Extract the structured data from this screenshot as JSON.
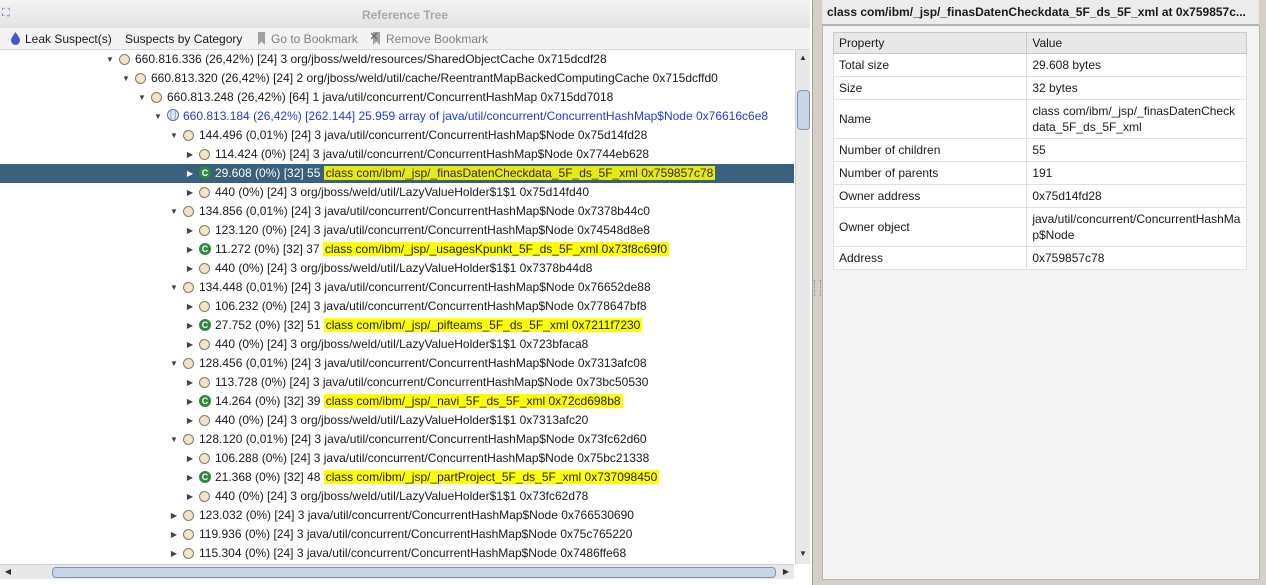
{
  "left_panel": {
    "title": "Reference Tree",
    "toolbar": {
      "leak_suspects": "Leak Suspect(s)",
      "suspects_by_category": "Suspects by Category",
      "go_to_bookmark": "Go to Bookmark",
      "remove_bookmark": "Remove Bookmark"
    },
    "rows": [
      {
        "level": 0,
        "kind": "node",
        "twist": "open",
        "text": "660.816.336 (26,42%) [24] 3 org/jboss/weld/resources/SharedObjectCache 0x715dcdf28"
      },
      {
        "level": 1,
        "kind": "node",
        "twist": "open",
        "text": "660.813.320 (26,42%) [24] 2 org/jboss/weld/util/cache/ReentrantMapBackedComputingCache 0x715dcffd0"
      },
      {
        "level": 2,
        "kind": "node",
        "twist": "open",
        "text": "660.813.248 (26,42%) [64] 1 java/util/concurrent/ConcurrentHashMap 0x715dd7018"
      },
      {
        "level": 3,
        "kind": "array",
        "twist": "open",
        "blue": true,
        "text": "660.813.184 (26,42%) [262.144] 25.959 array of java/util/concurrent/ConcurrentHashMap$Node 0x76616c6e8"
      },
      {
        "level": 4,
        "kind": "node",
        "twist": "open",
        "text": "144.496 (0,01%) [24] 3 java/util/concurrent/ConcurrentHashMap$Node 0x75d14fd28"
      },
      {
        "level": 5,
        "kind": "node",
        "twist": "closed",
        "text": "114.424 (0%) [24] 3 java/util/concurrent/ConcurrentHashMap$Node 0x7744eb628"
      },
      {
        "level": 5,
        "kind": "class",
        "twist": "closed",
        "selected": true,
        "text": "29.608 (0%) [32] 55 ",
        "hl": "class com/ibm/_jsp/_finasDatenCheckdata_5F_ds_5F_xml 0x759857c78"
      },
      {
        "level": 5,
        "kind": "node",
        "twist": "closed",
        "text": "440 (0%) [24] 3 org/jboss/weld/util/LazyValueHolder$1$1 0x75d14fd40"
      },
      {
        "level": 4,
        "kind": "node",
        "twist": "open",
        "text": "134.856 (0,01%) [24] 3 java/util/concurrent/ConcurrentHashMap$Node 0x7378b44c0"
      },
      {
        "level": 5,
        "kind": "node",
        "twist": "closed",
        "text": "123.120 (0%) [24] 3 java/util/concurrent/ConcurrentHashMap$Node 0x74548d8e8"
      },
      {
        "level": 5,
        "kind": "class",
        "twist": "closed",
        "text": "11.272 (0%) [32] 37 ",
        "hl": "class com/ibm/_jsp/_usagesKpunkt_5F_ds_5F_xml 0x73f8c69f0"
      },
      {
        "level": 5,
        "kind": "node",
        "twist": "closed",
        "text": "440 (0%) [24] 3 org/jboss/weld/util/LazyValueHolder$1$1 0x7378b44d8"
      },
      {
        "level": 4,
        "kind": "node",
        "twist": "open",
        "text": "134.448 (0,01%) [24] 3 java/util/concurrent/ConcurrentHashMap$Node 0x76652de88"
      },
      {
        "level": 5,
        "kind": "node",
        "twist": "closed",
        "text": "106.232 (0%) [24] 3 java/util/concurrent/ConcurrentHashMap$Node 0x778647bf8"
      },
      {
        "level": 5,
        "kind": "class",
        "twist": "closed",
        "text": "27.752 (0%) [32] 51 ",
        "hl": "class com/ibm/_jsp/_pifteams_5F_ds_5F_xml 0x7211f7230"
      },
      {
        "level": 5,
        "kind": "node",
        "twist": "closed",
        "text": "440 (0%) [24] 3 org/jboss/weld/util/LazyValueHolder$1$1 0x723bfaca8"
      },
      {
        "level": 4,
        "kind": "node",
        "twist": "open",
        "text": "128.456 (0,01%) [24] 3 java/util/concurrent/ConcurrentHashMap$Node 0x7313afc08"
      },
      {
        "level": 5,
        "kind": "node",
        "twist": "closed",
        "text": "113.728 (0%) [24] 3 java/util/concurrent/ConcurrentHashMap$Node 0x73bc50530"
      },
      {
        "level": 5,
        "kind": "class",
        "twist": "closed",
        "text": "14.264 (0%) [32] 39 ",
        "hl": "class com/ibm/_jsp/_navi_5F_ds_5F_xml 0x72cd698b8"
      },
      {
        "level": 5,
        "kind": "node",
        "twist": "closed",
        "text": "440 (0%) [24] 3 org/jboss/weld/util/LazyValueHolder$1$1 0x7313afc20"
      },
      {
        "level": 4,
        "kind": "node",
        "twist": "open",
        "text": "128.120 (0,01%) [24] 3 java/util/concurrent/ConcurrentHashMap$Node 0x73fc62d60"
      },
      {
        "level": 5,
        "kind": "node",
        "twist": "closed",
        "text": "106.288 (0%) [24] 3 java/util/concurrent/ConcurrentHashMap$Node 0x75bc21338"
      },
      {
        "level": 5,
        "kind": "class",
        "twist": "closed",
        "text": "21.368 (0%) [32] 48 ",
        "hl": "class com/ibm/_jsp/_partProject_5F_ds_5F_xml 0x737098450"
      },
      {
        "level": 5,
        "kind": "node",
        "twist": "closed",
        "text": "440 (0%) [24] 3 org/jboss/weld/util/LazyValueHolder$1$1 0x73fc62d78"
      },
      {
        "level": 4,
        "kind": "node",
        "twist": "closed",
        "text": "123.032 (0%) [24] 3 java/util/concurrent/ConcurrentHashMap$Node 0x766530690"
      },
      {
        "level": 4,
        "kind": "node",
        "twist": "closed",
        "text": "119.936 (0%) [24] 3 java/util/concurrent/ConcurrentHashMap$Node 0x75c765220"
      },
      {
        "level": 4,
        "kind": "node",
        "twist": "closed",
        "text": "115.304 (0%) [24] 3 java/util/concurrent/ConcurrentHashMap$Node 0x7486ffe68"
      }
    ]
  },
  "right_panel": {
    "title": "class com/ibm/_jsp/_finasDatenCheckdata_5F_ds_5F_xml at 0x759857c...",
    "headers": {
      "property": "Property",
      "value": "Value"
    },
    "properties": [
      {
        "name": "Total size",
        "value": "29.608 bytes"
      },
      {
        "name": "Size",
        "value": "32 bytes"
      },
      {
        "name": "Name",
        "value": "class com/ibm/_jsp/_finasDatenCheckdata_5F_ds_5F_xml"
      },
      {
        "name": "Number of children",
        "value": "55"
      },
      {
        "name": "Number of parents",
        "value": "191"
      },
      {
        "name": "Owner address",
        "value": "0x75d14fd28"
      },
      {
        "name": "Owner object",
        "value": "java/util/concurrent/ConcurrentHashMap$Node"
      },
      {
        "name": "Address",
        "value": "0x759857c78"
      }
    ]
  },
  "icons": {
    "tree": "tree-icon",
    "leak": "leak-suspect-icon",
    "bookmark": "bookmark-icon",
    "remove_bookmark": "remove-bookmark-icon"
  },
  "colors": {
    "selection": "#3a607d",
    "highlight": "#ffff00",
    "array_text": "#1e3fd6",
    "class_icon": "#2f8a3d"
  }
}
